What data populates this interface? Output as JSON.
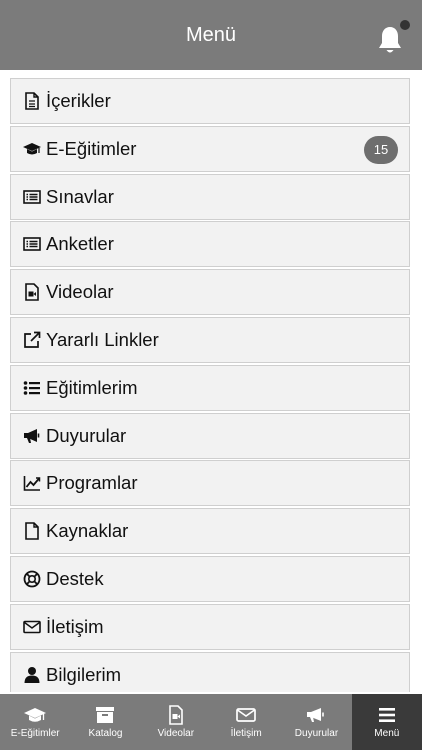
{
  "header": {
    "title": "Menü"
  },
  "menu": {
    "items": [
      {
        "label": "İçerikler",
        "icon": "document-icon"
      },
      {
        "label": "E-Eğitimler",
        "icon": "graduation-cap-icon",
        "badge": "15"
      },
      {
        "label": "Sınavlar",
        "icon": "list-card-icon"
      },
      {
        "label": "Anketler",
        "icon": "list-card-icon"
      },
      {
        "label": "Videolar",
        "icon": "video-file-icon"
      },
      {
        "label": "Yararlı Linkler",
        "icon": "external-link-icon"
      },
      {
        "label": "Eğitimlerim",
        "icon": "list-icon"
      },
      {
        "label": "Duyurular",
        "icon": "megaphone-icon"
      },
      {
        "label": "Programlar",
        "icon": "line-chart-icon"
      },
      {
        "label": "Kaynaklar",
        "icon": "file-icon"
      },
      {
        "label": "Destek",
        "icon": "life-ring-icon"
      },
      {
        "label": "İletişim",
        "icon": "envelope-icon"
      },
      {
        "label": "Bilgilerim",
        "icon": "user-icon"
      }
    ]
  },
  "tabbar": {
    "tabs": [
      {
        "label": "E-Eğitimler",
        "icon": "graduation-cap-icon"
      },
      {
        "label": "Katalog",
        "icon": "archive-box-icon"
      },
      {
        "label": "Videolar",
        "icon": "video-file-icon"
      },
      {
        "label": "İletişim",
        "icon": "envelope-icon"
      },
      {
        "label": "Duyurular",
        "icon": "megaphone-icon"
      },
      {
        "label": "Menü",
        "icon": "hamburger-icon"
      }
    ]
  },
  "colors": {
    "header": "#7b7b7b",
    "active_tab": "#3a3a3a",
    "row": "#f2f2f2",
    "badge": "#6e6e6e"
  }
}
